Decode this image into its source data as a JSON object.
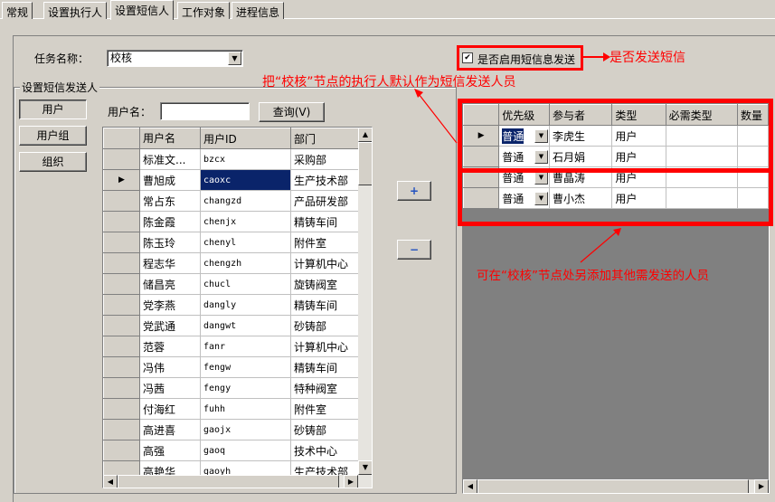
{
  "tabs": [
    "常规",
    "设置执行人",
    "设置短信人",
    "工作对象",
    "进程信息"
  ],
  "task": {
    "label": "任务名称：",
    "value": "校核"
  },
  "sms_enable": {
    "label": "是否启用短信息发送",
    "checked": true,
    "checkmark": "✔"
  },
  "group_label": "设置短信发送人",
  "left_buttons": [
    "用户",
    "用户组",
    "组织"
  ],
  "search": {
    "label": "用户名：",
    "value": "",
    "button": "查询(V)"
  },
  "user_grid": {
    "headers": [
      "用户名",
      "用户ID",
      "部门"
    ],
    "rows": [
      [
        "标准文...",
        "bzcx",
        "采购部"
      ],
      [
        "曹旭成",
        "caoxc",
        "生产技术部"
      ],
      [
        "常占东",
        "changzd",
        "产品研发部"
      ],
      [
        "陈金霞",
        "chenjx",
        "精铸车间"
      ],
      [
        "陈玉玲",
        "chenyl",
        "附件室"
      ],
      [
        "程志华",
        "chengzh",
        "计算机中心"
      ],
      [
        "储昌亮",
        "chucl",
        "旋铸阀室"
      ],
      [
        "党李燕",
        "dangly",
        "精铸车间"
      ],
      [
        "党武通",
        "dangwt",
        "砂铸部"
      ],
      [
        "范蓉",
        "fanr",
        "计算机中心"
      ],
      [
        "冯伟",
        "fengw",
        "精铸车间"
      ],
      [
        "冯茜",
        "fengy",
        "特种阀室"
      ],
      [
        "付海红",
        "fuhh",
        "附件室"
      ],
      [
        "高进喜",
        "gaojx",
        "砂铸部"
      ],
      [
        "高强",
        "gaoq",
        "技术中心"
      ],
      [
        "高艳华",
        "gaoyh",
        "生产技术部"
      ]
    ],
    "selected_row": 1
  },
  "move_buttons": {
    "add": "+",
    "remove": "−"
  },
  "recipient_grid": {
    "headers": [
      "优先级",
      "参与者",
      "类型",
      "必需类型",
      "数量"
    ],
    "rows": [
      [
        "普通",
        "李虎生",
        "用户",
        "",
        ""
      ],
      [
        "普通",
        "石月娟",
        "用户",
        "",
        ""
      ],
      [
        "普通",
        "曹晶涛",
        "用户",
        "",
        ""
      ],
      [
        "普通",
        "曹小杰",
        "用户",
        "",
        ""
      ]
    ]
  },
  "annotations": {
    "sms_note": "是否发送短信",
    "default_note": "把“校核”节点的执行人默认作为短信发送人员",
    "add_note": "可在“校核”节点处另添加其他需发送的人员"
  },
  "colors": {
    "annotation": "#ff0000",
    "selection": "#0a246a",
    "background": "#d4d0c8"
  }
}
